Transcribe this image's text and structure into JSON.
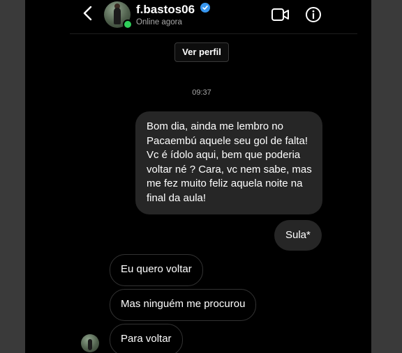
{
  "header": {
    "username": "f.bastos06",
    "status": "Online agora",
    "icons": [
      "back-arrow-icon",
      "verified-badge-icon",
      "video-call-icon",
      "info-icon"
    ]
  },
  "profile_button": "Ver perfil",
  "timestamp": "09:37",
  "messages": {
    "sent": [
      {
        "text": "Bom dia, ainda me lembro no Pacaembú aquele seu gol de falta! Vc é ídolo aqui, bem que poderia voltar né ? Cara, vc nem sabe, mas me fez muito feliz aquela noite na final da aula!"
      },
      {
        "text": "Sula*"
      }
    ],
    "received": [
      {
        "text": "Eu quero voltar"
      },
      {
        "text": "Mas ninguém me procurou"
      },
      {
        "text": "Para voltar"
      }
    ]
  },
  "colors": {
    "background": "#000000",
    "bubble": "#262626",
    "verified": "#3897f0",
    "online": "#2fcf5a",
    "muted_text": "#a8a8a8"
  }
}
